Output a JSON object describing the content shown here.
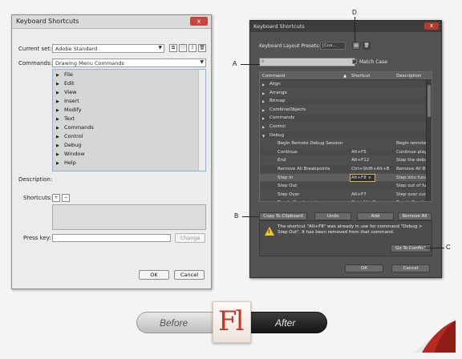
{
  "before_dialog": {
    "title": "Keyboard Shortcuts",
    "close": "x",
    "current_set_label": "Current set:",
    "current_set_value": "Adobe Standard",
    "commands_label": "Commands:",
    "commands_value": "Drawing Menu Commands",
    "tree_items": [
      "File",
      "Edit",
      "View",
      "Insert",
      "Modify",
      "Text",
      "Commands",
      "Control",
      "Debug",
      "Window",
      "Help"
    ],
    "description_label": "Description:",
    "shortcuts_label": "Shortcuts:",
    "add": "+",
    "remove": "−",
    "press_key_label": "Press key:",
    "change_button": "Change",
    "ok_button": "OK",
    "cancel_button": "Cancel"
  },
  "after_dialog": {
    "title": "Keyboard Shortcuts",
    "close": "x",
    "presets_label": "Keyboard Layout Presets:",
    "presets_value": "[Cus...",
    "search_placeholder": "",
    "match_case_label": "Match Case",
    "columns": {
      "command": "Command",
      "shortcut": "Shortcut",
      "description": "Description"
    },
    "rows": [
      {
        "type": "group",
        "command": "Align",
        "shortcut": "",
        "description": ""
      },
      {
        "type": "group",
        "command": "Arrange",
        "shortcut": "",
        "description": ""
      },
      {
        "type": "group",
        "command": "Bitmap",
        "shortcut": "",
        "description": ""
      },
      {
        "type": "group",
        "command": "CombineObjects",
        "shortcut": "",
        "description": ""
      },
      {
        "type": "group",
        "command": "Commands",
        "shortcut": "",
        "description": ""
      },
      {
        "type": "group",
        "command": "Control",
        "shortcut": "",
        "description": ""
      },
      {
        "type": "open",
        "command": "Debug",
        "shortcut": "",
        "description": ""
      },
      {
        "type": "child",
        "command": "Begin Remote Debug Session",
        "shortcut": "",
        "description": "Begin remote"
      },
      {
        "type": "child",
        "command": "Continue",
        "shortcut": "Alt+F5",
        "description": "Continue play"
      },
      {
        "type": "child",
        "command": "End",
        "shortcut": "Alt+F12",
        "description": "Stop the debu"
      },
      {
        "type": "child",
        "command": "Remove All Breakpoints",
        "shortcut": "Ctrl+Shift+Alt+B",
        "description": "Remove All Br"
      },
      {
        "type": "edit",
        "command": "Step In",
        "shortcut": "Alt+F8",
        "description": "Step into func"
      },
      {
        "type": "child",
        "command": "Step Out",
        "shortcut": "",
        "description": "Step out of fu"
      },
      {
        "type": "child",
        "command": "Step Over",
        "shortcut": "Alt+F7",
        "description": "Step over curr"
      },
      {
        "type": "child",
        "command": "Toggle Breakpoint",
        "shortcut": "Ctrl+Alt+B",
        "description": "Toggle Break"
      }
    ],
    "copy_clipboard_button": "Copy To Clipboard",
    "undo_button": "Undo",
    "add_button": "Add",
    "remove_all_button": "Remove All",
    "warning_text": "The shortcut \"Alt+F8\" was already in use for command \"Debug > Step Out\". It has been removed from that command.",
    "go_to_conflict_button": "Go To Conflict",
    "ok_button": "OK",
    "cancel_button": "Cancel"
  },
  "callouts": {
    "a": "A",
    "b": "B",
    "c": "C",
    "d": "D"
  },
  "banner": {
    "before": "Before",
    "after": "After",
    "logo": "Fl"
  },
  "colors": {
    "accent_orange": "#e0b84a",
    "warning_yellow": "#f4c430",
    "logo_red": "#c0392b",
    "close_red": "#c8443c"
  }
}
